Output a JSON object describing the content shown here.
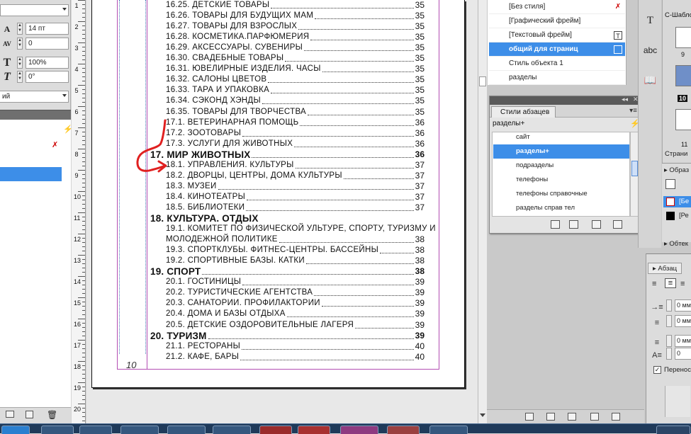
{
  "left_panel": {
    "font_size": "14 пт",
    "tracking": "0",
    "vertical_scale": "100%",
    "skew": "0°",
    "language_partial": "ий"
  },
  "ruler": {
    "numbers": [
      "1",
      "2",
      "3",
      "4",
      "5",
      "6",
      "7",
      "8",
      "9",
      "10",
      "11",
      "12",
      "13",
      "14",
      "15",
      "16",
      "17",
      "18",
      "19",
      "20"
    ]
  },
  "document": {
    "page_number": "10",
    "toc": [
      {
        "t": "16.25.  ДЕТСКИЕ ТОВАРЫ",
        "p": "35"
      },
      {
        "t": "16.26.  ТОВАРЫ ДЛЯ БУДУЩИХ МАМ",
        "p": "35"
      },
      {
        "t": "16.27.  ТОВАРЫ ДЛЯ ВЗРОСЛЫХ",
        "p": "35"
      },
      {
        "t": "16.28.  КОСМЕТИКА.ПАРФЮМЕРИЯ",
        "p": "35"
      },
      {
        "t": "16.29.  АКСЕССУАРЫ. СУВЕНИРЫ",
        "p": "35"
      },
      {
        "t": "16.30.  СВАДЕБНЫЕ ТОВАРЫ",
        "p": "35"
      },
      {
        "t": "16.31.  ЮВЕЛИРНЫЕ ИЗДЕЛИЯ. ЧАСЫ",
        "p": "35"
      },
      {
        "t": "16.32.  САЛОНЫ ЦВЕТОВ",
        "p": "35"
      },
      {
        "t": "16.33.  ТАРА И УПАКОВКА",
        "p": "35"
      },
      {
        "t": "16.34.  СЭКОНД ХЭНДЫ",
        "p": "35"
      },
      {
        "t": "16.35.  ТОВАРЫ ДЛЯ ТВОРЧЕСТВА",
        "p": "35"
      },
      {
        "t": "17.1.  ВЕТЕРИНАРНАЯ ПОМОЩЬ",
        "p": "36"
      },
      {
        "t": "17.2.  ЗООТОВАРЫ",
        "p": "36"
      },
      {
        "t": "17.3.  УСЛУГИ ДЛЯ ЖИВОТНЫХ",
        "p": "36"
      },
      {
        "t": "17. МИР ЖИВОТНЫХ",
        "p": "36",
        "h": true
      },
      {
        "t": "18.1.  УПРАВЛЕНИЯ. КУЛЬТУРЫ",
        "p": "37"
      },
      {
        "t": "18.2.  ДВОРЦЫ, ЦЕНТРЫ, ДОМА КУЛЬТУРЫ",
        "p": "37"
      },
      {
        "t": "18.3.  МУЗЕИ",
        "p": "37"
      },
      {
        "t": "18.4.  КИНОТЕАТРЫ",
        "p": "37"
      },
      {
        "t": "18.5.  БИБЛИОТЕКИ",
        "p": "37"
      },
      {
        "t": "18. КУЛЬТУРА. ОТДЫХ",
        "p": "",
        "h": true
      },
      {
        "t": "19.1.  КОМИТЕТ ПО ФИЗИЧЕСКОЙ УЛЬТУРЕ, СПОРТУ, ТУРИЗМУ И",
        "p": "",
        "wrap": true
      },
      {
        "t": "МОЛОДЕЖНОЙ ПОЛИТИКЕ",
        "p": "38"
      },
      {
        "t": "19.3.  СПОРТКЛУБЫ. ФИТНЕС-ЦЕНТРЫ. БАССЕЙНЫ",
        "p": "38"
      },
      {
        "t": "19.2.  СПОРТИВНЫЕ  БАЗЫ.  КАТКИ",
        "p": "38"
      },
      {
        "t": "19. СПОРТ",
        "p": "38",
        "h": true
      },
      {
        "t": "20.1.  ГОСТИНИЦЫ",
        "p": "39"
      },
      {
        "t": "20.2.  ТУРИСТИЧЕСКИЕ АГЕНТСТВА",
        "p": "39"
      },
      {
        "t": "20.3.  САНАТОРИИ. ПРОФИЛАКТОРИИ",
        "p": "39"
      },
      {
        "t": "20.4.  ДОМА И БАЗЫ ОТДЫХА",
        "p": "39"
      },
      {
        "t": "20.5.  ДЕТСКИЕ ОЗДОРОВИТЕЛЬНЫЕ ЛАГЕРЯ",
        "p": "39"
      },
      {
        "t": "20. ТУРИЗМ",
        "p": "39",
        "h": true
      },
      {
        "t": "21.1.  РЕСТОРАНЫ",
        "p": "40"
      },
      {
        "t": "21.2.  КАФЕ, БАРЫ",
        "p": "40"
      }
    ]
  },
  "object_styles": {
    "items": [
      {
        "label": "[Без стиля]",
        "selected": false,
        "icon": "cross-pen"
      },
      {
        "label": "[Графический фрейм]",
        "selected": false,
        "icon": ""
      },
      {
        "label": "[Текстовый фрейм]",
        "selected": false,
        "icon": "T"
      },
      {
        "label": "общий для страниц",
        "selected": true,
        "icon": "frame"
      },
      {
        "label": "Стиль объекта 1",
        "selected": false,
        "icon": ""
      },
      {
        "label": "разделы",
        "selected": false,
        "icon": ""
      }
    ]
  },
  "paragraph_styles": {
    "tab_label": "Стили абзацев",
    "current_style": "разделы+",
    "items": [
      {
        "label": "сайт",
        "selected": false
      },
      {
        "label": "разделы+",
        "selected": true
      },
      {
        "label": "подразделы",
        "selected": false
      },
      {
        "label": "телефоны",
        "selected": false
      },
      {
        "label": "телефоны справочные",
        "selected": false
      },
      {
        "label": "разделы справ тел",
        "selected": false
      }
    ]
  },
  "pages_panel": {
    "master_label": "С-Шабло",
    "page_labels": [
      "9",
      "10",
      "11"
    ],
    "pages_button": "Страни"
  },
  "samples_panel": {
    "title": "Образ",
    "row1": "[Бе",
    "row2": "[Ре",
    "footer": "Обтек"
  },
  "para_format": {
    "title": "Абзац",
    "field1": "0 мм",
    "field2": "0 мм",
    "field3": "0 мм",
    "field4": "0",
    "hyphen_label": "Перенос"
  },
  "colors": {
    "selection": "#3d8ee8",
    "margin_guide": "#b34db3",
    "annotation": "#e02020"
  }
}
